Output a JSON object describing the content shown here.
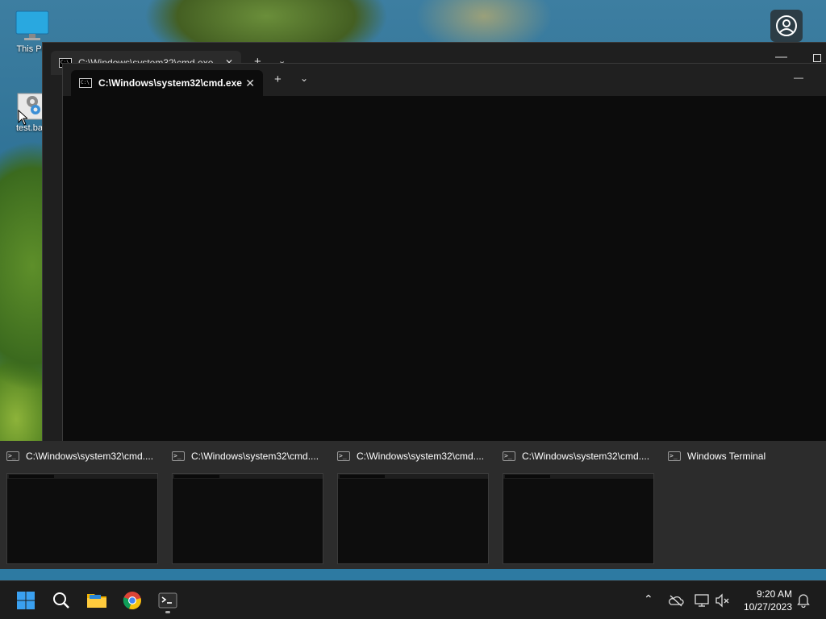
{
  "desktop": {
    "icons": [
      {
        "label": "This PC"
      },
      {
        "label": "test.bat"
      }
    ]
  },
  "window_back": {
    "tab_title": "C:\\Windows\\system32\\cmd.exe"
  },
  "window_front": {
    "tab_title": "C:\\Windows\\system32\\cmd.exe",
    "new_tab": "+",
    "dropdown": "⌄",
    "minimize": "—"
  },
  "switcher": {
    "items": [
      {
        "title": "C:\\Windows\\system32\\cmd...."
      },
      {
        "title": "C:\\Windows\\system32\\cmd...."
      },
      {
        "title": "C:\\Windows\\system32\\cmd...."
      },
      {
        "title": "C:\\Windows\\system32\\cmd...."
      },
      {
        "title": "Windows Terminal"
      }
    ]
  },
  "taskbar": {
    "apps": [
      "start-icon",
      "search-icon",
      "file-explorer-icon",
      "chrome-icon",
      "terminal-icon"
    ],
    "tray": [
      "chevron-up-icon",
      "onedrive-icon",
      "network-icon",
      "volume-muted-icon",
      "notification-bell-icon"
    ],
    "time": "9:20 AM",
    "date": "10/27/2023"
  },
  "colors": {
    "accent": "#0078d4",
    "terminal_bg": "#0c0c0c",
    "titlebar": "#202020",
    "taskbar": "#1c1c1c"
  }
}
